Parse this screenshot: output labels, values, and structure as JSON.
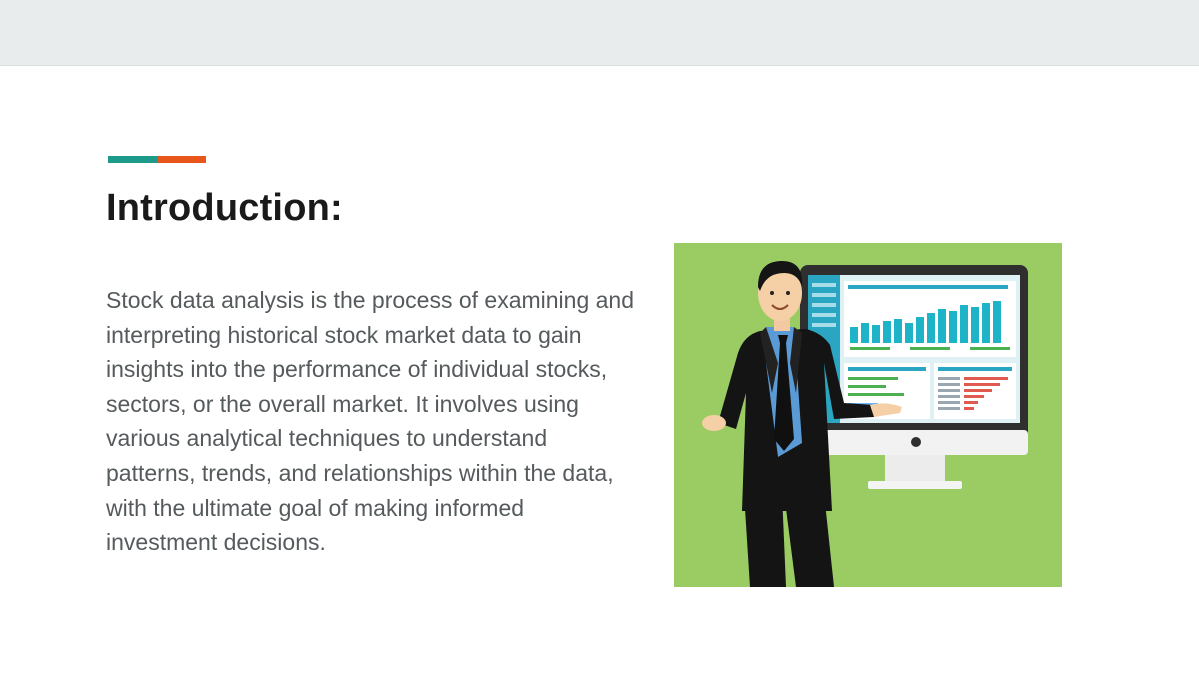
{
  "slide": {
    "title": "Introduction:",
    "body": "Stock data analysis is the process of examining and interpreting historical stock market data to gain insights into the performance of individual stocks, sectors, or the overall market. It involves using various analytical techniques to understand patterns, trends, and relationships within the data, with the ultimate goal of making informed investment decisions."
  },
  "colors": {
    "header_bar": "#e8eced",
    "accent_teal": "#1d9a8a",
    "accent_orange": "#e8561c",
    "title": "#1a1a1a",
    "body_text": "#555a5c",
    "illustration_bg": "#9bcc63"
  },
  "illustration": {
    "subject": "businessman presenting stock dashboard on monitor"
  }
}
